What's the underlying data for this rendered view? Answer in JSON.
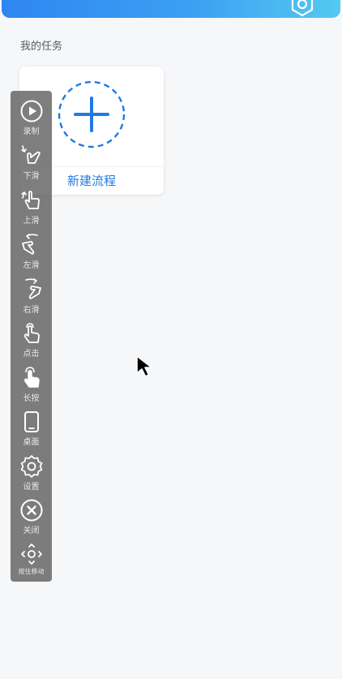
{
  "header": {
    "title": "",
    "gradient_from": "#2f86f0",
    "gradient_to": "#54c9f0",
    "icon": "settings-hex-icon"
  },
  "tasks": {
    "section_label": "我的任务",
    "new_flow_label": "新建流程",
    "accent_color": "#1f7be3"
  },
  "toolbar": {
    "items": [
      {
        "label": "录制",
        "icon": "record-icon"
      },
      {
        "label": "下滑",
        "icon": "swipe-down-icon"
      },
      {
        "label": "上滑",
        "icon": "swipe-up-icon"
      },
      {
        "label": "左滑",
        "icon": "swipe-left-icon"
      },
      {
        "label": "右滑",
        "icon": "swipe-right-icon"
      },
      {
        "label": "点击",
        "icon": "tap-icon"
      },
      {
        "label": "长按",
        "icon": "long-press-icon"
      },
      {
        "label": "桌面",
        "icon": "phone-icon"
      },
      {
        "label": "设置",
        "icon": "gear-icon"
      },
      {
        "label": "关闭",
        "icon": "close-icon"
      },
      {
        "label": "按住移动",
        "icon": "move-icon"
      }
    ]
  }
}
